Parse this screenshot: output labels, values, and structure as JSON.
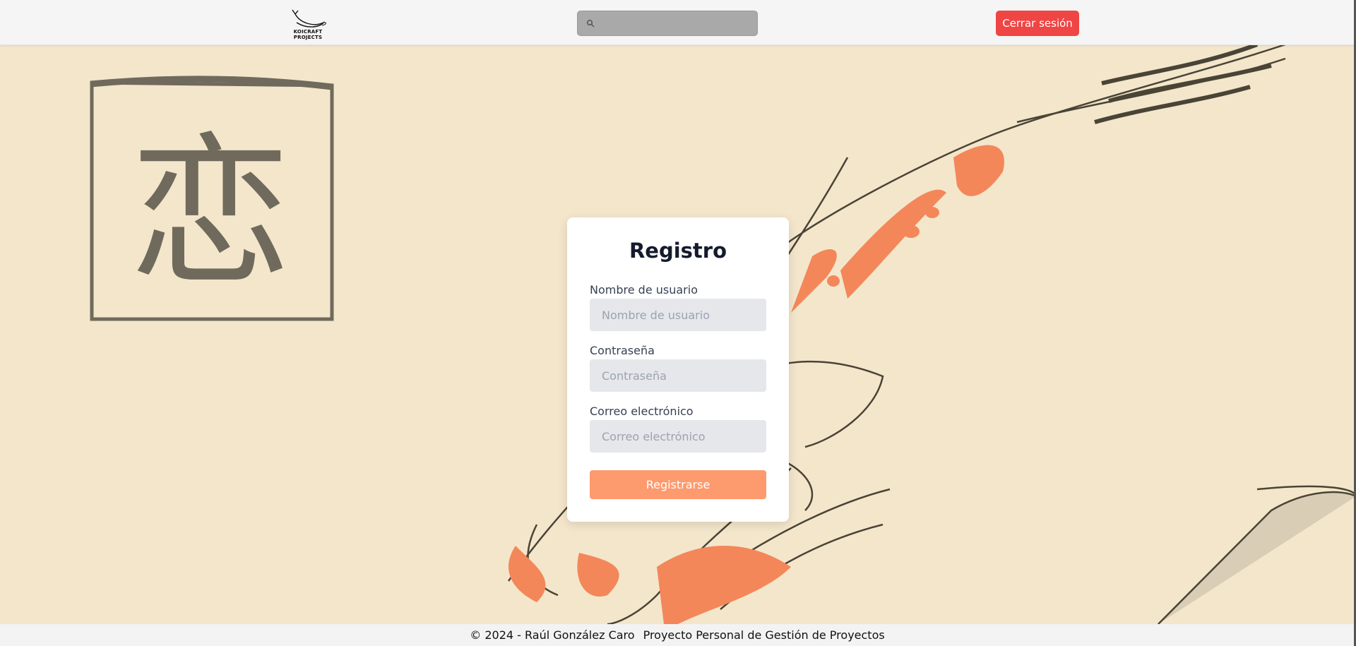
{
  "header": {
    "logo_text": "KOICRAFT PROJECTS",
    "search_placeholder": "",
    "logout_label": "Cerrar sesión"
  },
  "background": {
    "kanji": "恋"
  },
  "register": {
    "title": "Registro",
    "username_label": "Nombre de usuario",
    "username_placeholder": "Nombre de usuario",
    "password_label": "Contraseña",
    "password_placeholder": "Contraseña",
    "email_label": "Correo electrónico",
    "email_placeholder": "Correo electrónico",
    "submit_label": "Registrarse"
  },
  "footer": {
    "copyright": "© 2024 - Raúl González Caro",
    "project": "Proyecto Personal de Gestión de Proyectos"
  },
  "colors": {
    "accent_red": "#ef4545",
    "accent_orange": "#fd9a6e",
    "background": "#f3e6cb"
  }
}
